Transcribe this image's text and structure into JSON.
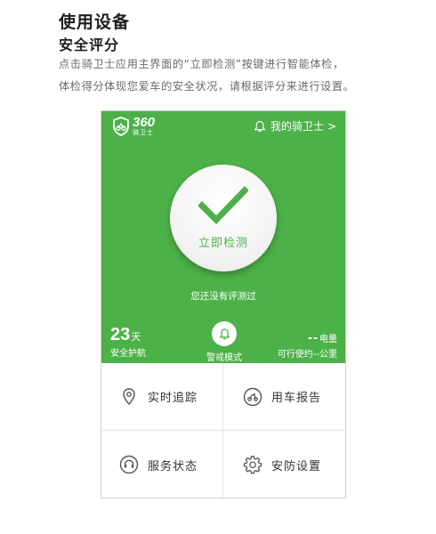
{
  "doc": {
    "title": "使用设备",
    "subtitle": "安全评分",
    "desc_line1": "点击骑卫士应用主界面的“立即检测”按键进行智能体检，",
    "desc_line2": "体检得分体现您爱车的安全状况，请根据评分来进行设置。"
  },
  "app": {
    "logo_number": "360",
    "logo_name": "骑卫士",
    "my_rider_label": "我的骑卫士",
    "chevron": ">",
    "check_button_label": "立即检测",
    "not_tested_text": "您还没有评测过",
    "days_value": "23",
    "days_unit": "天",
    "days_label": "安全护航",
    "guard_label": "警戒模式",
    "power_value": "--",
    "power_unit": "电量",
    "power_label": "可行使约--公里",
    "menu": [
      {
        "label": "实时追踪",
        "icon": "location-pin-icon"
      },
      {
        "label": "用车报告",
        "icon": "scooter-report-icon"
      },
      {
        "label": "服务状态",
        "icon": "headset-icon"
      },
      {
        "label": "安防设置",
        "icon": "gear-icon"
      }
    ],
    "colors": {
      "primary_green": "#4db149",
      "white": "#ffffff",
      "text_dark": "#333333"
    }
  }
}
